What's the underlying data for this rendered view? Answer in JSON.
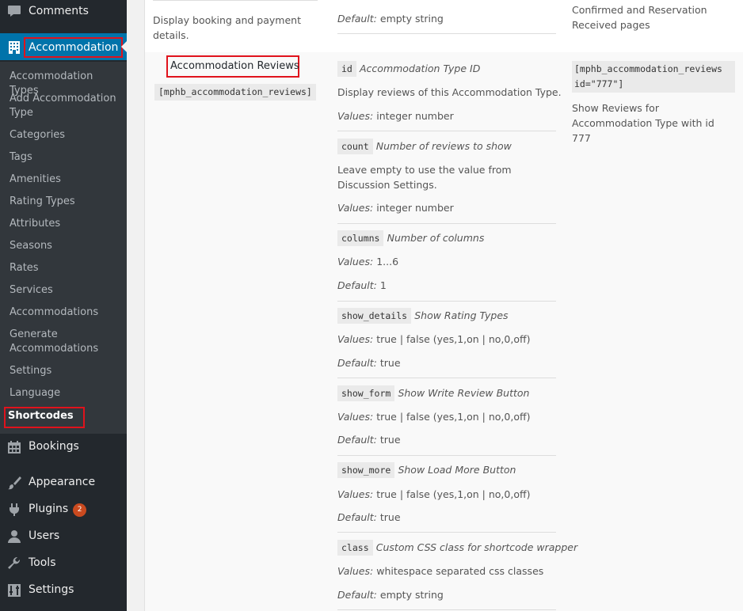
{
  "sidebar": {
    "top_items": [
      {
        "label": "Comments",
        "icon": "comment-icon"
      },
      {
        "label": "Accommodation",
        "icon": "building-icon"
      }
    ],
    "submenu": [
      "Accommodation Types",
      "Add Accommodation Type",
      "Categories",
      "Tags",
      "Amenities",
      "Rating Types",
      "Attributes",
      "Seasons",
      "Rates",
      "Services",
      "Accommodations",
      "Generate Accommodations",
      "Settings",
      "Language",
      "Shortcodes"
    ],
    "bottom_items": [
      {
        "label": "Bookings",
        "icon": "calendar-icon"
      },
      {
        "label": "Appearance",
        "icon": "paintbrush-icon"
      },
      {
        "label": "Plugins",
        "icon": "plugin-icon",
        "badge": "2"
      },
      {
        "label": "Users",
        "icon": "user-icon"
      },
      {
        "label": "Tools",
        "icon": "wrench-icon"
      },
      {
        "label": "Settings",
        "icon": "settings-icon"
      }
    ],
    "colors": {
      "bg": "#23282d",
      "submenu_bg": "#32373c",
      "active": "#0073aa",
      "highlight_border": "#e0121c",
      "badge": "#ca4a1f"
    }
  },
  "previous_row": {
    "description": "Display booking and payment details.",
    "default_label": "Default:",
    "default_value": "empty string",
    "example_text": "Confirmed and Reservation Received pages"
  },
  "shortcode_row": {
    "name": "Accommodation Reviews",
    "shortcode": "[mphb_accommodation_reviews]",
    "example_code": "[mphb_accommodation_reviews id=\"777\"]",
    "example_text": "Show Reviews for Accommodation Type with id 777",
    "params": [
      {
        "code": "id",
        "title": "Accommodation Type ID",
        "lines": [
          {
            "label": "",
            "value": "Display reviews of this Accommodation Type."
          },
          {
            "label": "Values:",
            "value": "integer number"
          }
        ]
      },
      {
        "code": "count",
        "title": "Number of reviews to show",
        "lines": [
          {
            "label": "",
            "value": "Leave empty to use the value from Discussion Settings."
          },
          {
            "label": "Values:",
            "value": "integer number"
          }
        ]
      },
      {
        "code": "columns",
        "title": "Number of columns",
        "lines": [
          {
            "label": "Values:",
            "value": "1...6"
          },
          {
            "label": "Default:",
            "value": "1"
          }
        ]
      },
      {
        "code": "show_details",
        "title": "Show Rating Types",
        "lines": [
          {
            "label": "Values:",
            "value": "true | false (yes,1,on | no,0,off)"
          },
          {
            "label": "Default:",
            "value": "true"
          }
        ]
      },
      {
        "code": "show_form",
        "title": "Show Write Review Button",
        "lines": [
          {
            "label": "Values:",
            "value": "true | false (yes,1,on | no,0,off)"
          },
          {
            "label": "Default:",
            "value": "true"
          }
        ]
      },
      {
        "code": "show_more",
        "title": "Show Load More Button",
        "lines": [
          {
            "label": "Values:",
            "value": "true | false (yes,1,on | no,0,off)"
          },
          {
            "label": "Default:",
            "value": "true"
          }
        ]
      },
      {
        "code": "class",
        "title": "Custom CSS class for shortcode wrapper",
        "lines": [
          {
            "label": "Values:",
            "value": "whitespace separated css classes"
          },
          {
            "label": "Default:",
            "value": "empty string"
          }
        ]
      }
    ]
  }
}
